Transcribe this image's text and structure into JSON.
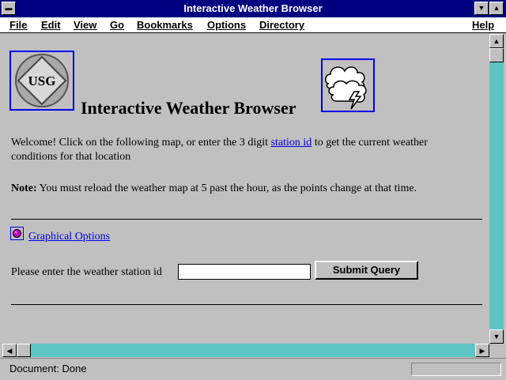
{
  "window": {
    "title": "Interactive Weather Browser"
  },
  "menubar": {
    "items": [
      "File",
      "Edit",
      "View",
      "Go",
      "Bookmarks",
      "Options",
      "Directory"
    ],
    "help": "Help"
  },
  "page": {
    "logo_text": "USG",
    "heading": "Interactive Weather Browser",
    "intro_before": "Welcome! Click on the following map, or enter the 3 digit ",
    "intro_link": "station id",
    "intro_after": " to get the current weather",
    "intro_line2": "conditions for that location",
    "note_label": "Note:",
    "note_text": "You must reload the weather map at 5 past the hour, as the points change at that time.",
    "graphical_options_link": "Graphical Options",
    "input_label": "Please enter the weather station id",
    "input_value": "",
    "submit_label": "Submit Query"
  },
  "status": {
    "text": "Document: Done"
  }
}
